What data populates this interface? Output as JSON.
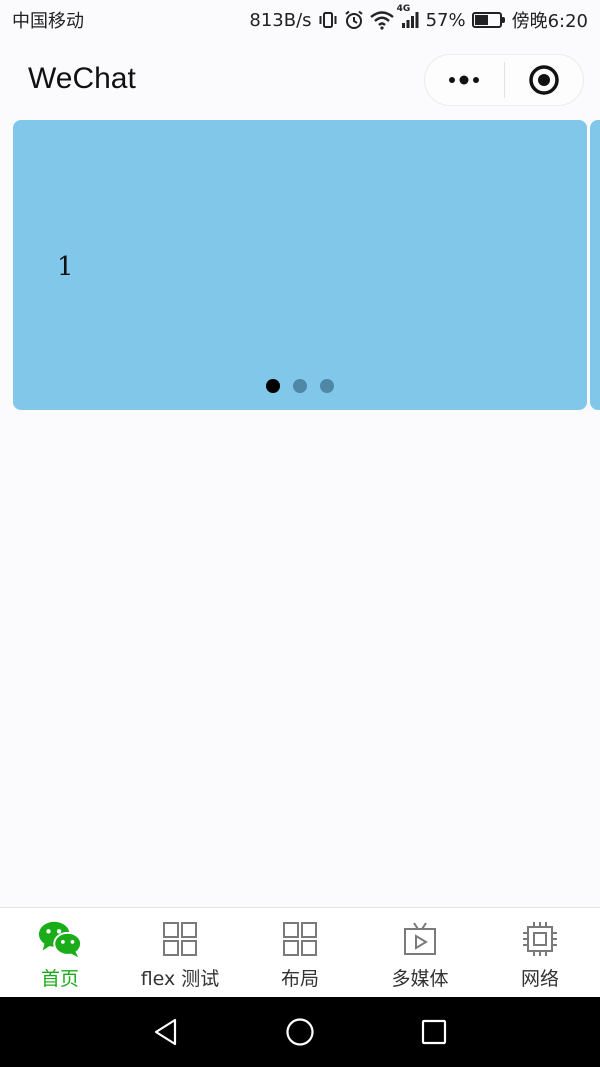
{
  "status_bar": {
    "carrier": "中国移动",
    "speed": "813B/s",
    "signal_label": "4G",
    "battery_percent": "57%",
    "battery_level": 0.57,
    "time": "傍晚6:20"
  },
  "nav": {
    "title": "WeChat",
    "more_icon": "more-dots-icon",
    "close_icon": "target-circle-icon"
  },
  "swiper": {
    "slide_text": "1",
    "slide_color": "#80c7ea",
    "dot_count": 3,
    "active_dot": 0
  },
  "tabs": [
    {
      "label": "首页",
      "icon": "wechat-chat-icon",
      "active": true
    },
    {
      "label": "flex 测试",
      "icon": "grid-icon",
      "active": false
    },
    {
      "label": "布局",
      "icon": "grid-icon",
      "active": false
    },
    {
      "label": "多媒体",
      "icon": "tv-play-icon",
      "active": false
    },
    {
      "label": "网络",
      "icon": "chip-icon",
      "active": false
    }
  ],
  "colors": {
    "accent": "#1aad19",
    "page_bg": "#fbfafd",
    "inactive_icon": "#7a7a7a"
  }
}
